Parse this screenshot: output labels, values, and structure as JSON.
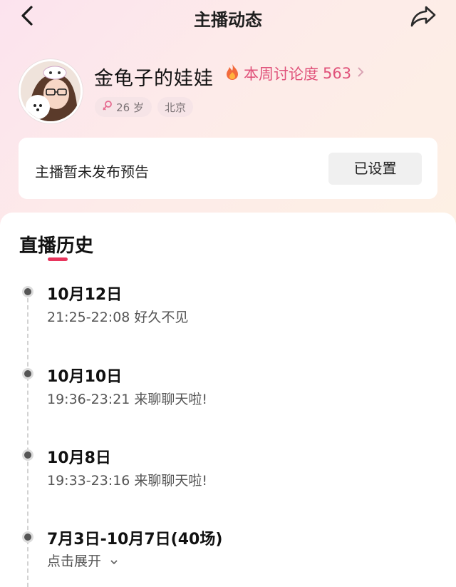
{
  "header": {
    "title": "主播动态"
  },
  "profile": {
    "name": "金龟子的娃娃",
    "hot_label": "本周讨论度",
    "hot_value": "563",
    "age": "26 岁",
    "city": "北京"
  },
  "notice": {
    "text": "主播暂未发布预告",
    "button": "已设置"
  },
  "history": {
    "title": "直播历史",
    "entries": [
      {
        "date": "10月12日",
        "detail": "21:25-22:08 好久不见"
      },
      {
        "date": "10月10日",
        "detail": "19:36-23:21 来聊聊天啦!"
      },
      {
        "date": "10月8日",
        "detail": "19:33-23:16 来聊聊天啦!"
      },
      {
        "date": "7月3日-10月7日(40场)",
        "detail": "点击展开"
      }
    ]
  },
  "colors": {
    "accent": "#e8355d",
    "hot_text": "#e0527a",
    "tag_bg": "#f6e4e7"
  },
  "icons": [
    "back-icon",
    "share-icon",
    "fire-icon",
    "chevron-right-icon",
    "female-icon",
    "timeline-dot",
    "chevron-down-icon"
  ]
}
